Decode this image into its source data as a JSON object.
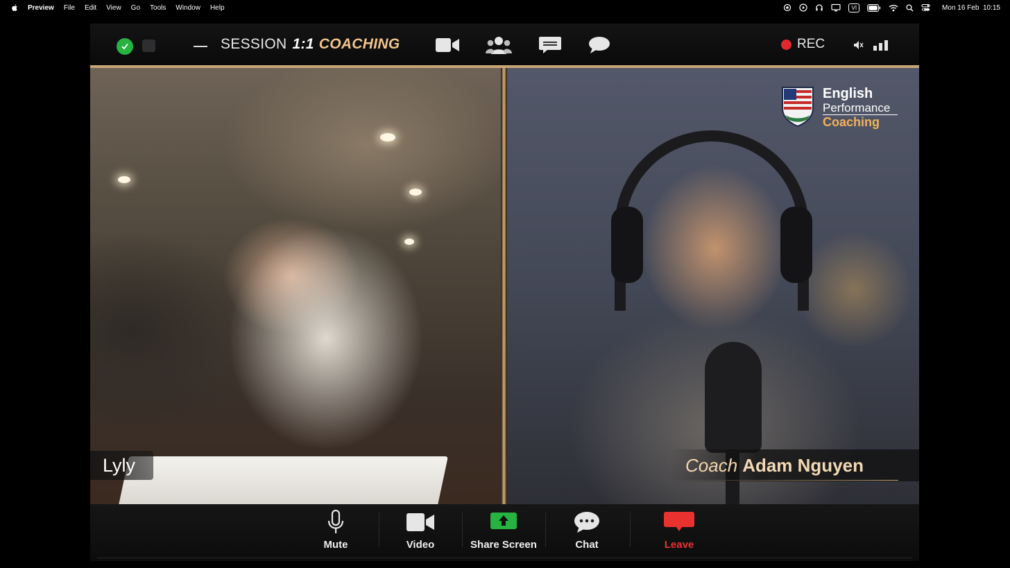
{
  "menubar": {
    "app": "Preview",
    "items": [
      "File",
      "Edit",
      "View",
      "Go",
      "Tools",
      "Window",
      "Help"
    ],
    "status_icons": [
      "camera-icon",
      "play-circle-icon",
      "headphones-icon",
      "display-icon",
      "vi-badge-icon",
      "battery-icon",
      "wifi-icon",
      "search-icon",
      "control-center-icon"
    ],
    "vi_label": "VI",
    "clock": "Mon 16 Feb  10:15"
  },
  "session": {
    "word": "SESSION",
    "number": "1:1",
    "type": "COACHING",
    "rec_label": "REC"
  },
  "titlebar_icons": [
    "video-camera-icon",
    "participants-icon",
    "captions-icon",
    "chat-bubbles-icon",
    "mute-speaker-icon",
    "signal-bars-icon"
  ],
  "participants": {
    "left": {
      "name": "Lyly"
    },
    "right": {
      "role": "Coach",
      "name": "Adam Nguyen"
    }
  },
  "logo": {
    "line1": "English",
    "line2": "Performance",
    "line3": "Coaching"
  },
  "toolbar": {
    "mute": "Mute",
    "video": "Video",
    "share": "Share Screen",
    "chat": "Chat",
    "leave": "Leave"
  },
  "colors": {
    "accent_gold": "#f2c48a",
    "rec_red": "#e0282e",
    "share_green": "#27b342",
    "leave_red": "#e8322f"
  }
}
